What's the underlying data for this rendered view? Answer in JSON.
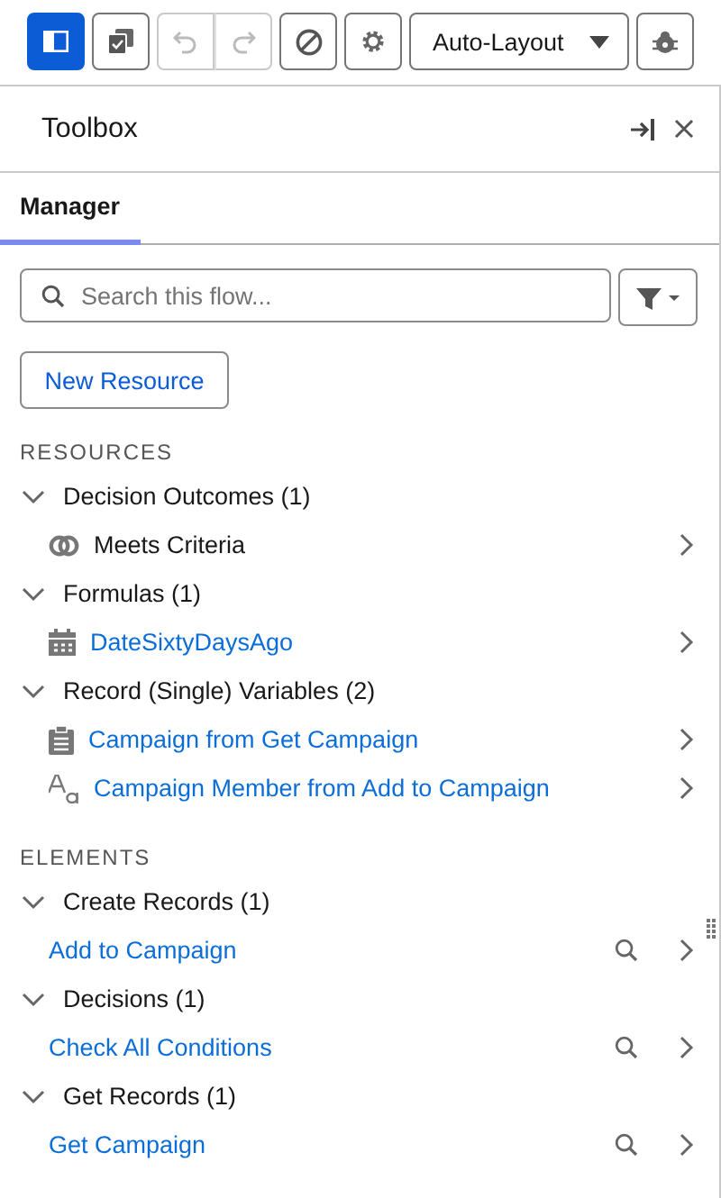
{
  "toolbar": [
    {
      "kind": "panel",
      "selected": true,
      "disabled": false
    },
    {
      "kind": "copy",
      "selected": false,
      "disabled": false
    },
    {
      "kind": "undo",
      "selected": false,
      "disabled": true
    },
    {
      "kind": "redo",
      "selected": false,
      "disabled": true
    },
    {
      "kind": "block",
      "selected": false,
      "disabled": false
    },
    {
      "kind": "gear",
      "selected": false,
      "disabled": false
    },
    {
      "kind": "dropdown",
      "label": "Auto-Layout",
      "selected": false,
      "disabled": false
    },
    {
      "kind": "debug",
      "selected": false,
      "disabled": false
    }
  ],
  "panel": {
    "title": "Toolbox",
    "tabs": [
      {
        "label": "Manager",
        "selected": true
      }
    ],
    "search": {
      "placeholder": "Search this flow..."
    },
    "new_button": "New Resource",
    "sections": [
      {
        "heading": "RESOURCES",
        "groups": [
          {
            "label": "Decision Outcomes (1)",
            "expanded": true,
            "items": [
              {
                "label": "Meets Criteria",
                "kind": "outcome",
                "link": false
              }
            ]
          },
          {
            "label": "Formulas (1)",
            "expanded": true,
            "items": [
              {
                "label": "DateSixtyDaysAgo",
                "kind": "date",
                "link": true
              }
            ]
          },
          {
            "label": "Record (Single) Variables (2)",
            "expanded": true,
            "items": [
              {
                "label": "Campaign from Get Campaign",
                "kind": "record",
                "link": true
              },
              {
                "label": "Campaign Member from Add to Campaign",
                "kind": "text",
                "link": true
              }
            ]
          }
        ]
      },
      {
        "heading": "ELEMENTS",
        "groups": [
          {
            "label": "Create Records (1)",
            "expanded": true,
            "items": [
              {
                "label": "Add to Campaign",
                "kind": "element",
                "link": true
              }
            ]
          },
          {
            "label": "Decisions (1)",
            "expanded": true,
            "items": [
              {
                "label": "Check All Conditions",
                "kind": "element",
                "link": true
              }
            ]
          },
          {
            "label": "Get Records (1)",
            "expanded": true,
            "items": [
              {
                "label": "Get Campaign",
                "kind": "element",
                "link": true
              }
            ]
          }
        ]
      }
    ]
  }
}
